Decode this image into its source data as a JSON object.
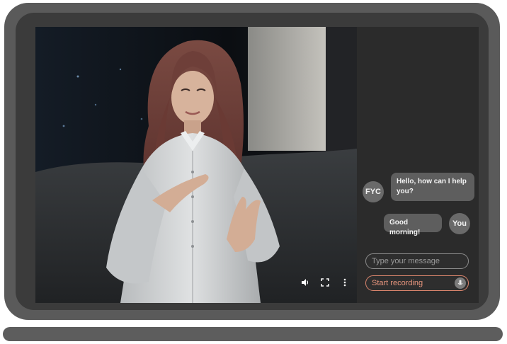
{
  "chat": {
    "assistant_avatar": "FYC",
    "user_avatar": "You",
    "messages": [
      {
        "sender": "assistant",
        "text": "Hello, how can I help you?"
      },
      {
        "sender": "user",
        "text": "Good morning!"
      }
    ],
    "input_placeholder": "Type your message",
    "record_label": "Start recording"
  },
  "video_controls": {
    "icons": [
      "speaker-icon",
      "fullscreen-icon",
      "more-vertical-icon"
    ]
  },
  "colors": {
    "frame": "#5a5a5a",
    "panel": "#2b2b2b",
    "bubble": "#5e5e5e",
    "record_accent": "#e8967e"
  }
}
